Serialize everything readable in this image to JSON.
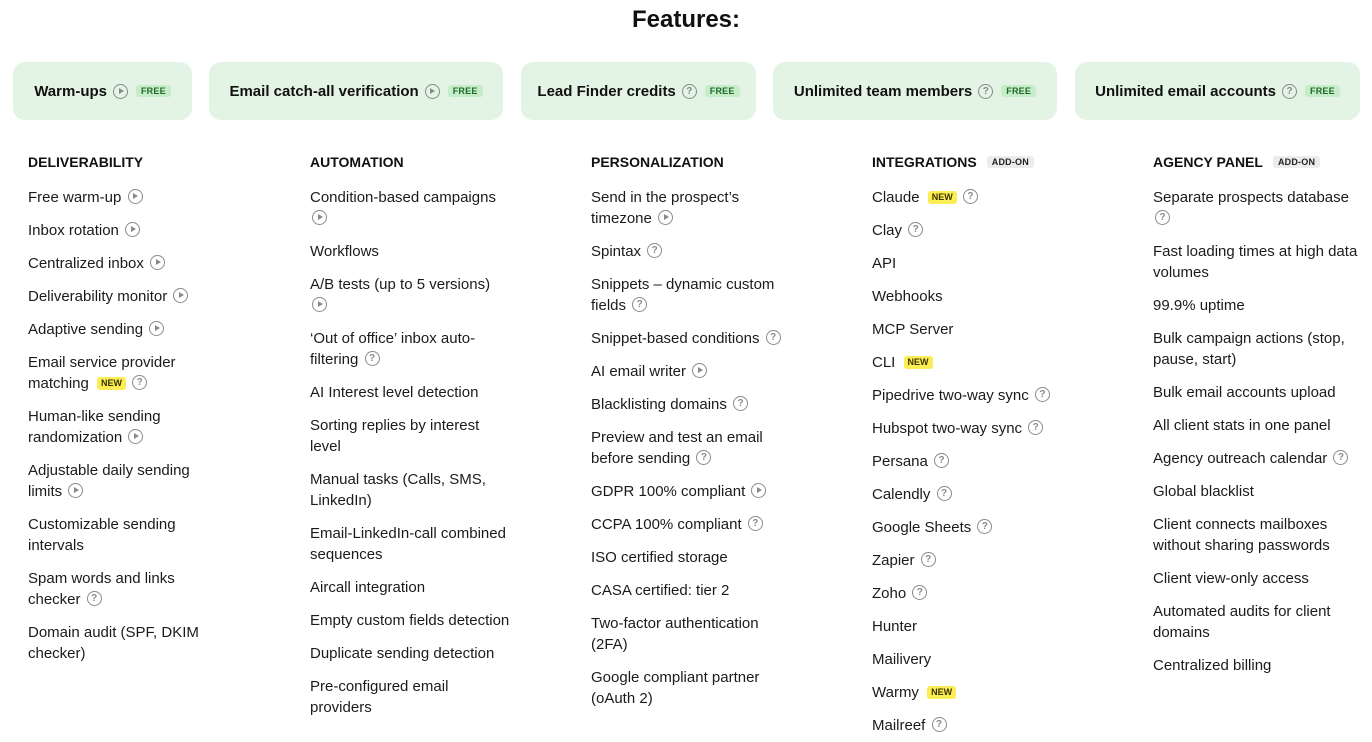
{
  "title": "Features:",
  "pills": [
    {
      "label": "Warm-ups",
      "icon": "play-icon",
      "badge": "FREE"
    },
    {
      "label": "Email catch-all verification",
      "icon": "play-icon",
      "badge": "FREE"
    },
    {
      "label": "Lead Finder credits",
      "icon": "help-icon",
      "badge": "FREE"
    },
    {
      "label": "Unlimited team members",
      "icon": "help-icon",
      "badge": "FREE"
    },
    {
      "label": "Unlimited email accounts",
      "icon": "help-icon",
      "badge": "FREE"
    }
  ],
  "columns": [
    {
      "heading": "DELIVERABILITY",
      "items": [
        {
          "text": "Free warm-up",
          "icon": "play-icon"
        },
        {
          "text": "Inbox rotation",
          "icon": "play-icon"
        },
        {
          "text": "Centralized inbox",
          "icon": "play-icon"
        },
        {
          "text": "Deliverability monitor",
          "icon": "play-icon"
        },
        {
          "text": "Adaptive sending",
          "icon": "play-icon"
        },
        {
          "text": "Email service provider matching",
          "badge": "NEW",
          "icon": "help-icon"
        },
        {
          "text": "Human-like sending randomization",
          "icon": "play-icon"
        },
        {
          "text": "Adjustable daily sending limits",
          "icon": "play-icon"
        },
        {
          "text": "Customizable sending intervals"
        },
        {
          "text": "Spam words and links checker",
          "icon": "help-icon"
        },
        {
          "text": "Domain audit (SPF, DKIM checker)"
        }
      ]
    },
    {
      "heading": "AUTOMATION",
      "items": [
        {
          "text": "Condition-based campaigns",
          "icon": "play-icon"
        },
        {
          "text": "Workflows"
        },
        {
          "text": "A/B tests (up to 5 versions)",
          "icon": "play-icon"
        },
        {
          "text": "‘Out of office’ inbox auto-filtering",
          "icon": "help-icon"
        },
        {
          "text": "AI Interest level detection"
        },
        {
          "text": "Sorting replies by interest level"
        },
        {
          "text": "Manual tasks (Calls, SMS, LinkedIn)"
        },
        {
          "text": "Email-LinkedIn-call combined sequences"
        },
        {
          "text": "Aircall integration"
        },
        {
          "text": "Empty custom fields detection"
        },
        {
          "text": "Duplicate sending detection"
        },
        {
          "text": "Pre-configured email providers"
        }
      ]
    },
    {
      "heading": "PERSONALIZATION",
      "items": [
        {
          "text": "Send in the prospect’s timezone",
          "icon": "play-icon"
        },
        {
          "text": "Spintax",
          "icon": "help-icon"
        },
        {
          "text": "Snippets – dynamic custom fields",
          "icon": "help-icon"
        },
        {
          "text": "Snippet-based conditions",
          "icon": "help-icon"
        },
        {
          "text": "AI email writer",
          "icon": "play-icon"
        },
        {
          "text": "Blacklisting domains",
          "icon": "help-icon"
        },
        {
          "text": "Preview and test an email before sending",
          "icon": "help-icon"
        },
        {
          "text": "GDPR 100% compliant",
          "icon": "play-icon"
        },
        {
          "text": "CCPA 100% compliant",
          "icon": "help-icon"
        },
        {
          "text": "ISO certified storage"
        },
        {
          "text": "CASA certified: tier 2"
        },
        {
          "text": "Two-factor authentication (2FA)"
        },
        {
          "text": "Google compliant partner (oAuth 2)"
        }
      ]
    },
    {
      "heading": "INTEGRATIONS",
      "heading_badge": "ADD-ON",
      "items": [
        {
          "text": "Claude",
          "badge": "NEW",
          "icon": "help-icon"
        },
        {
          "text": "Clay",
          "icon": "help-icon"
        },
        {
          "text": "API"
        },
        {
          "text": "Webhooks"
        },
        {
          "text": "MCP Server"
        },
        {
          "text": "CLI",
          "badge": "NEW"
        },
        {
          "text": "Pipedrive two-way sync",
          "icon": "help-icon"
        },
        {
          "text": "Hubspot two-way sync",
          "icon": "help-icon"
        },
        {
          "text": "Persana",
          "icon": "help-icon"
        },
        {
          "text": "Calendly",
          "icon": "help-icon"
        },
        {
          "text": "Google Sheets",
          "icon": "help-icon"
        },
        {
          "text": "Zapier",
          "icon": "help-icon"
        },
        {
          "text": "Zoho",
          "icon": "help-icon"
        },
        {
          "text": "Hunter"
        },
        {
          "text": "Mailivery"
        },
        {
          "text": "Warmy",
          "badge": "NEW"
        },
        {
          "text": "Mailreef",
          "icon": "help-icon"
        }
      ]
    },
    {
      "heading": "AGENCY PANEL",
      "heading_badge": "ADD-ON",
      "items": [
        {
          "text": "Separate prospects database",
          "icon": "help-icon"
        },
        {
          "text": "Fast loading times at high data volumes"
        },
        {
          "text": "99.9% uptime"
        },
        {
          "text": "Bulk campaign actions (stop, pause, start)"
        },
        {
          "text": "Bulk email accounts upload"
        },
        {
          "text": "All client stats in one panel"
        },
        {
          "text": "Agency outreach calendar",
          "icon": "help-icon"
        },
        {
          "text": "Global blacklist"
        },
        {
          "text": "Client connects mailboxes without sharing passwords"
        },
        {
          "text": "Client view-only access"
        },
        {
          "text": "Automated audits for client domains"
        },
        {
          "text": "Centralized billing"
        }
      ]
    }
  ]
}
